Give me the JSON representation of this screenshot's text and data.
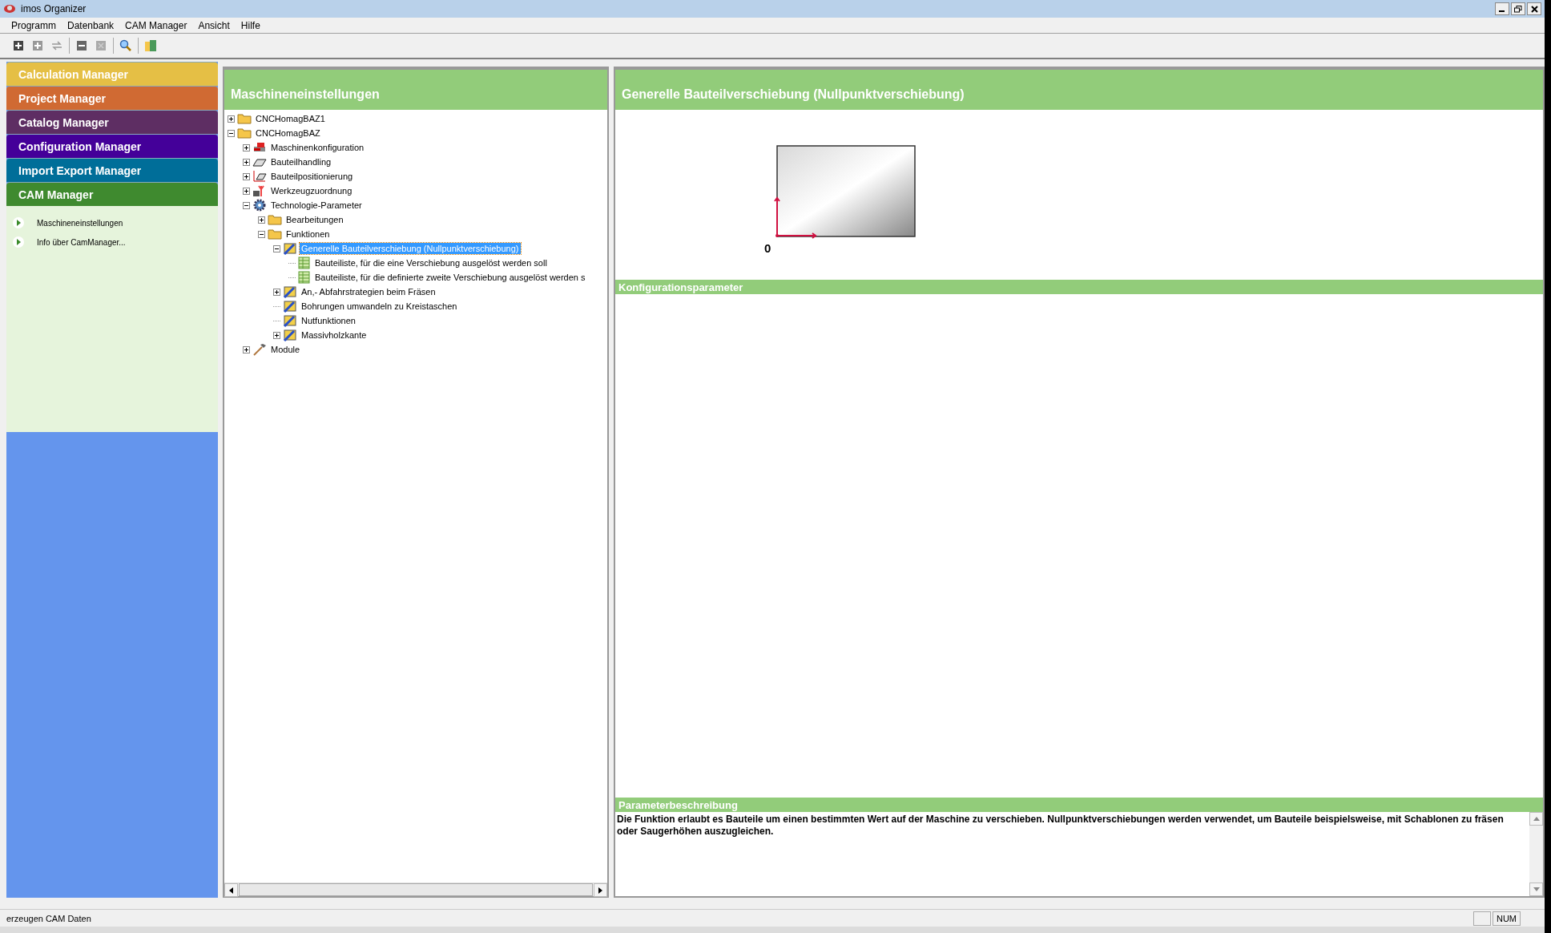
{
  "window": {
    "title": "imos Organizer"
  },
  "menu": [
    "Programm",
    "Datenbank",
    "CAM Manager",
    "Ansicht",
    "Hilfe"
  ],
  "managers": [
    {
      "label": "Calculation Manager",
      "color": "#e5bf45",
      "selected": false
    },
    {
      "label": "Project Manager",
      "color": "#d06a33",
      "selected": false
    },
    {
      "label": "Catalog Manager",
      "color": "#5e2e63",
      "selected": false
    },
    {
      "label": "Configuration Manager",
      "color": "#440099",
      "selected": false
    },
    {
      "label": "Import Export Manager",
      "color": "#006e99",
      "selected": false
    },
    {
      "label": "CAM Manager",
      "color": "#3f8a2f",
      "selected": true
    }
  ],
  "manager_items": [
    "Maschineneinstellungen",
    "Info über CamManager..."
  ],
  "tree_panel": {
    "title": "Maschineneinstellungen"
  },
  "tree": [
    {
      "label": "CNCHomagBAZ1",
      "kind": "folder",
      "expanded": false,
      "selected": false
    },
    {
      "label": "CNCHomagBAZ",
      "kind": "folder",
      "expanded": true,
      "selected": false,
      "children": [
        {
          "label": "Maschinenkonfiguration",
          "kind": "machine",
          "expanded": false,
          "selected": false
        },
        {
          "label": "Bauteilhandling",
          "kind": "part",
          "expanded": false,
          "selected": false
        },
        {
          "label": "Bauteilpositionierung",
          "kind": "position",
          "expanded": false,
          "selected": false
        },
        {
          "label": "Werkzeugzuordnung",
          "kind": "tool",
          "expanded": false,
          "selected": false
        },
        {
          "label": "Technologie-Parameter",
          "kind": "gear",
          "expanded": true,
          "selected": false,
          "children": [
            {
              "label": "Bearbeitungen",
              "kind": "folder",
              "expanded": false,
              "selected": false
            },
            {
              "label": "Funktionen",
              "kind": "folder",
              "expanded": true,
              "selected": false,
              "children": [
                {
                  "label": "Generelle Bauteilverschiebung (Nullpunktverschiebung)",
                  "kind": "function",
                  "expanded": true,
                  "selected": true,
                  "children": [
                    {
                      "label": "Bauteiliste, für die eine Verschiebung ausgelöst werden soll",
                      "kind": "list",
                      "selected": false
                    },
                    {
                      "label": "Bauteiliste, für die definierte zweite Verschiebung ausgelöst werden s",
                      "kind": "list",
                      "selected": false
                    }
                  ]
                },
                {
                  "label": "An,- Abfahrstrategien beim Fräsen",
                  "kind": "function",
                  "expanded": false,
                  "selected": false
                },
                {
                  "label": "Bohrungen umwandeln zu Kreistaschen",
                  "kind": "function",
                  "selected": false
                },
                {
                  "label": "Nutfunktionen",
                  "kind": "function",
                  "selected": false
                },
                {
                  "label": "Massivholzkante",
                  "kind": "function",
                  "expanded": false,
                  "selected": false
                }
              ]
            }
          ]
        },
        {
          "label": "Module",
          "kind": "hammer",
          "expanded": false,
          "selected": false
        }
      ]
    }
  ],
  "detail": {
    "title": "Generelle Bauteilverschiebung (Nullpunktverschiebung)",
    "origin_label": "0",
    "config_title": "Konfigurationsparameter",
    "description_title": "Parameterbeschreibung",
    "description": "Die Funktion erlaubt es Bauteile um einen bestimmten Wert auf der Maschine zu verschieben. Nullpunktverschiebungen werden verwendet, um Bauteile beispielsweise,  mit Schablonen zu fräsen oder Saugerhöhen auszugleichen."
  },
  "status_bar": {
    "message": "erzeugen CAM Daten",
    "indicator": "NUM"
  }
}
